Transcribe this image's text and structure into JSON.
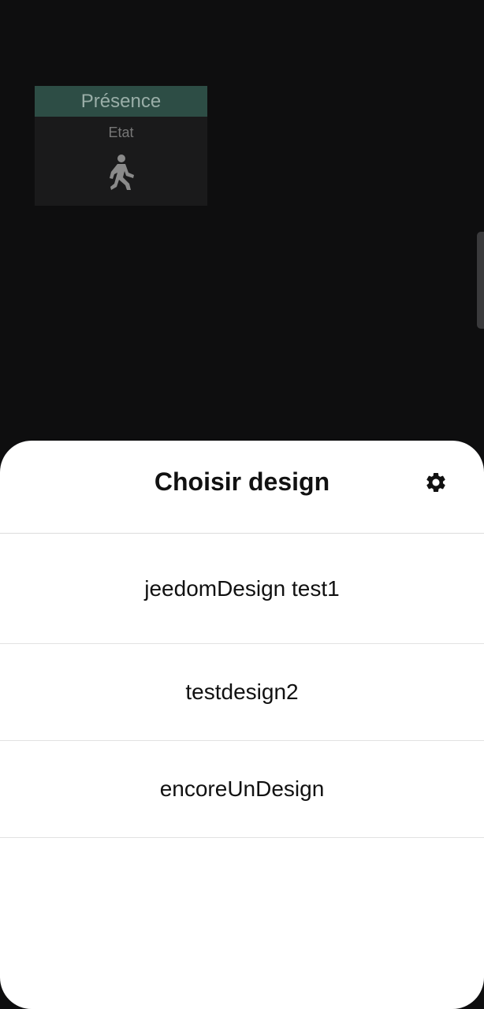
{
  "widget": {
    "title": "Présence",
    "command_label": "Etat",
    "icon": "person-walking-icon"
  },
  "sheet": {
    "title": "Choisir design",
    "settings_icon": "gear-icon",
    "designs": [
      {
        "label": "jeedomDesign test1"
      },
      {
        "label": "testdesign2"
      },
      {
        "label": "encoreUnDesign"
      }
    ]
  },
  "colors": {
    "background": "#0e0e0f",
    "widget_header": "#2d4d45",
    "sheet_background": "#ffffff"
  }
}
